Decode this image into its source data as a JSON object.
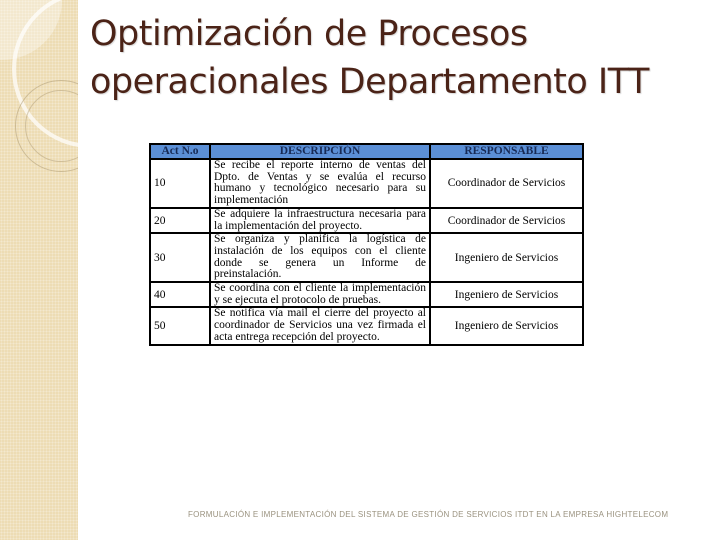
{
  "title": {
    "line1": "Optimización de Procesos",
    "line2": "operacionales Departamento ITT"
  },
  "table": {
    "headers": [
      "Act N.o",
      "DESCRIPCIÓN",
      "RESPONSABLE"
    ],
    "header_color": "#5b8fd6",
    "rows": [
      {
        "act": "10",
        "description": "Se recibe el reporte interno de ventas del Dpto. de Ventas y se evalúa el recurso humano y tecnológico necesario para su implementación",
        "responsible": "Coordinador de Servicios"
      },
      {
        "act": "20",
        "description": "Se adquiere la infraestructura necesaria para la implementación del proyecto.",
        "responsible": "Coordinador de Servicios"
      },
      {
        "act": "30",
        "description": "Se organiza y planifica la logística de instalación de los equipos con el cliente donde se genera un Informe de preinstalación.",
        "responsible": "Ingeniero de Servicios"
      },
      {
        "act": "40",
        "description": "Se coordina con el cliente la implementación y se ejecuta el protocolo de pruebas.",
        "responsible": "Ingeniero de Servicios"
      },
      {
        "act": "50",
        "description": "Se notifica vía mail el cierre del proyecto al coordinador de Servicios una vez firmada el acta entrega recepción del proyecto.",
        "responsible": "Ingeniero de Servicios"
      }
    ]
  },
  "footer": "FORMULACIÓN E IMPLEMENTACIÓN DEL SISTEMA DE GESTIÓN DE SERVICIOS ITDT EN LA EMPRESA HIGHTELECOM"
}
